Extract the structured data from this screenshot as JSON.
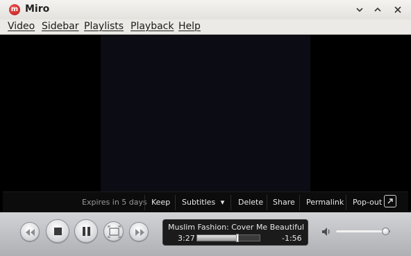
{
  "window": {
    "title": "Miro",
    "app_icon_letter": "m",
    "buttons": {
      "minimize": "⌄",
      "maximize": "⌃",
      "close": "✕"
    }
  },
  "menu": {
    "items": [
      "Video",
      "Sidebar",
      "Playlists",
      "Playback",
      "Help"
    ]
  },
  "info_bar": {
    "expires": "Expires in 5 days",
    "keep": "Keep",
    "subtitles": "Subtitles",
    "subtitles_arrow": "▾",
    "delete": "Delete",
    "share": "Share",
    "permalink": "Permalink",
    "popout": "Pop-out"
  },
  "player": {
    "title": "Muslim Fashion: Cover Me Beautiful",
    "elapsed": "3:27",
    "remaining": "-1:56",
    "progress_fraction": 0.64,
    "volume_fraction": 0.92
  },
  "icons": {
    "skip_back": "rewind-icon",
    "stop": "stop-icon",
    "pause": "pause-icon",
    "fullscreen": "fullscreen-icon",
    "skip_forward": "fast-forward-icon",
    "volume": "speaker-icon",
    "popout": "popout-icon"
  },
  "colors": {
    "accent_red": "#d11b1b",
    "info_bar_bg": "#0c0c0c",
    "control_bg": "#c4c5c8"
  }
}
